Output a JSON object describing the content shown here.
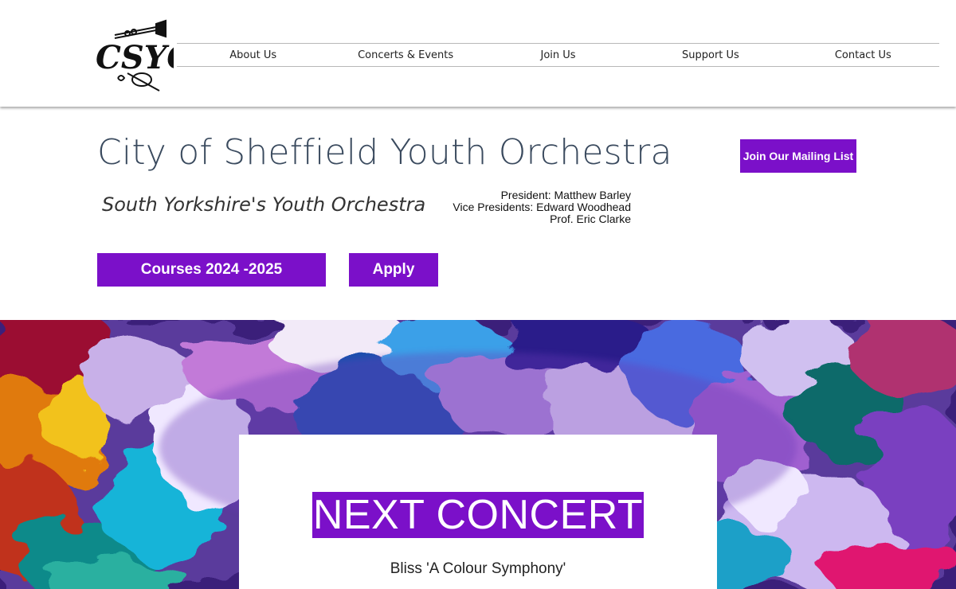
{
  "header": {
    "logo_text": "CSYO",
    "nav": [
      {
        "label": "About Us"
      },
      {
        "label": "Concerts & Events"
      },
      {
        "label": "Join Us"
      },
      {
        "label": "Support Us"
      },
      {
        "label": "Contact Us"
      }
    ]
  },
  "hero": {
    "title": "City of Sheffield Youth Orchestra",
    "tagline": "South Yorkshire's Youth Orchestra",
    "officers": [
      "President: Matthew Barley",
      "Vice Presidents: Edward Woodhead",
      "Prof. Eric Clarke"
    ],
    "mailing_button": "Join Our Mailing List",
    "courses_button": "Courses 2024 -2025",
    "apply_button": "Apply"
  },
  "concert": {
    "heading": "NEXT CONCERT",
    "piece": "Bliss 'A Colour Symphony'"
  },
  "colors": {
    "accent": "#7b10c9",
    "title": "#3a4a5e"
  }
}
